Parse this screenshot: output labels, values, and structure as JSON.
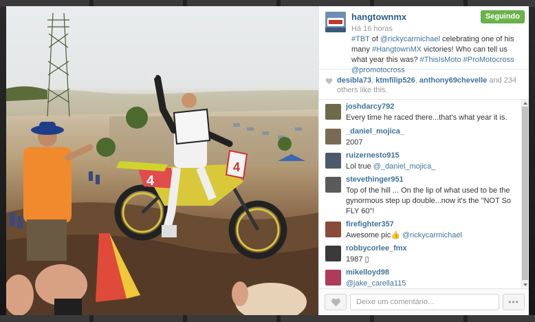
{
  "post": {
    "username": "hangtownmx",
    "follow_label": "Seguindo",
    "timestamp": "Há 16 horas",
    "caption_parts": [
      {
        "text": "#TBT",
        "tag": true
      },
      {
        "text": " of ",
        "tag": false
      },
      {
        "text": "@rickycarmichael",
        "tag": true
      },
      {
        "text": " celebrating one of his many ",
        "tag": false
      },
      {
        "text": "#HangtownMX",
        "tag": true
      },
      {
        "text": " victories! Who can tell us what year this was? ",
        "tag": false
      },
      {
        "text": "#ThisIsMoto",
        "tag": true
      },
      {
        "text": " ",
        "tag": false
      },
      {
        "text": "#ProMotocross",
        "tag": true
      },
      {
        "text": " ",
        "tag": false
      },
      {
        "text": "@promotocross",
        "tag": true
      }
    ]
  },
  "likes": {
    "users": [
      "desibla73",
      "ktmfilip526",
      "anthony69chevelle"
    ],
    "separator": ", ",
    "suffix": " and 234 others like this."
  },
  "comments": [
    {
      "user": "joshdarcy792",
      "parts": [
        {
          "text": "Every time he raced there...that's what year it is.",
          "mention": false
        }
      ],
      "avatar_color": "#6d6a4c"
    },
    {
      "user": "_daniel_mojica_",
      "parts": [
        {
          "text": "2007",
          "mention": false
        }
      ],
      "avatar_color": "#7a6a55"
    },
    {
      "user": "ruizernesto915",
      "parts": [
        {
          "text": "Lol true ",
          "mention": false
        },
        {
          "text": "@_daniel_mojica_",
          "mention": true
        }
      ],
      "avatar_color": "#4d5a6a"
    },
    {
      "user": "stevethinger951",
      "parts": [
        {
          "text": "Top of the hill ... On the lip of what used to be the gynormous step up double...now it's the \"NOT So FLY 60\"!",
          "mention": false
        }
      ],
      "avatar_color": "#5a5a5a"
    },
    {
      "user": "firefighter357",
      "parts": [
        {
          "text": "Awesome pic👍 ",
          "mention": false
        },
        {
          "text": "@rickycarmichael",
          "mention": true
        }
      ],
      "avatar_color": "#8a4a3a"
    },
    {
      "user": "robbycorlee_fmx",
      "parts": [
        {
          "text": "1987 ",
          "mention": false
        },
        {
          "text": "▯",
          "mention": false
        }
      ],
      "avatar_color": "#3a3a3a"
    },
    {
      "user": "mikelloyd98",
      "parts": [
        {
          "text": "@jake_carella115",
          "mention": true
        }
      ],
      "avatar_color": "#b03a5a"
    }
  ],
  "footer": {
    "comment_placeholder": "Deixe um comentário...",
    "more_label": "•••"
  },
  "photo": {
    "number_plate": "4"
  },
  "colors": {
    "link": "#3f729b",
    "follow_green": "#6bb34a",
    "muted": "#999999"
  },
  "icons": [
    "heart-icon",
    "more-options-icon",
    "scroll-up-icon",
    "scroll-down-icon"
  ]
}
